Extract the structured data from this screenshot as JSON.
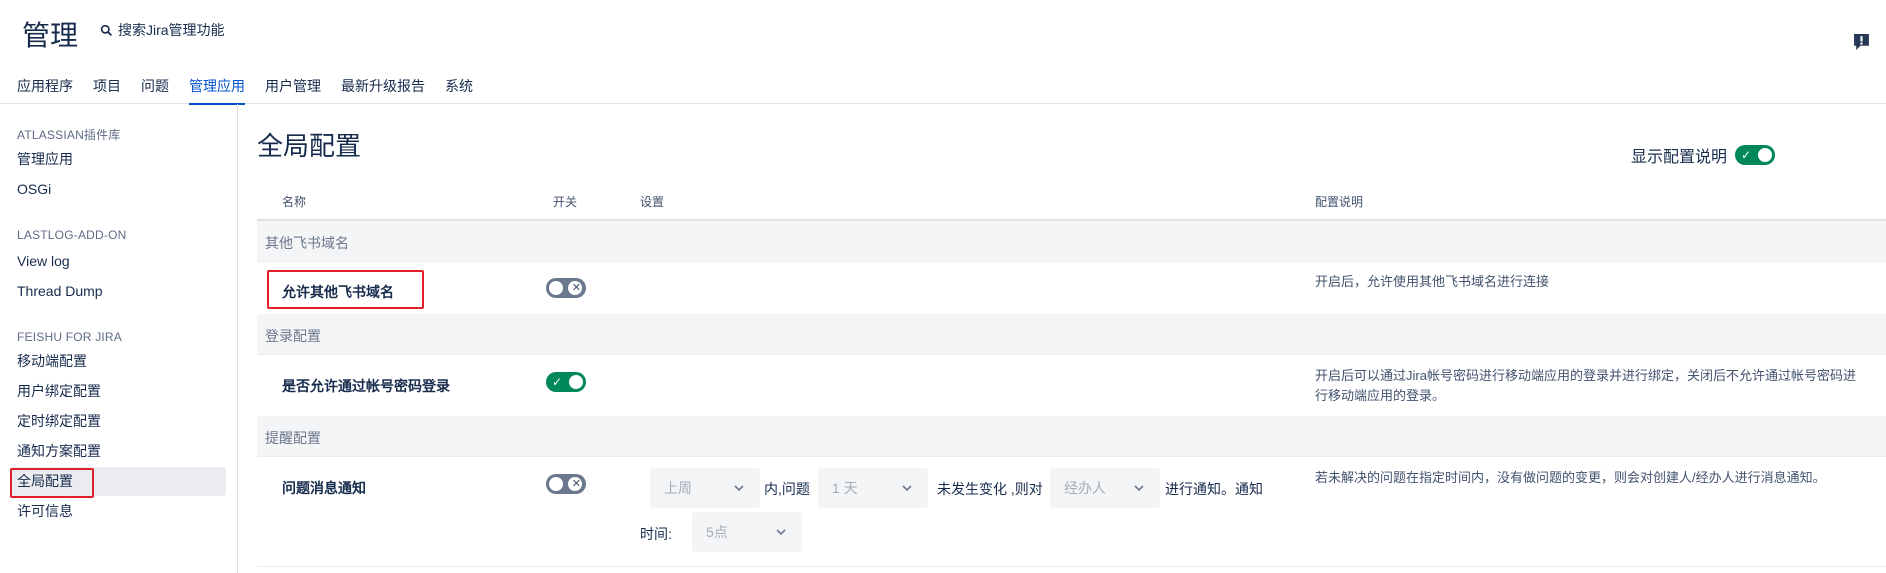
{
  "header": {
    "title": "管理",
    "search_label": "搜索Jira管理功能"
  },
  "tabs": [
    {
      "label": "应用程序"
    },
    {
      "label": "项目"
    },
    {
      "label": "问题"
    },
    {
      "label": "管理应用",
      "active": true
    },
    {
      "label": "用户管理"
    },
    {
      "label": "最新升级报告"
    },
    {
      "label": "系统"
    }
  ],
  "sidebar": {
    "sections": [
      {
        "title": "ATLASSIAN插件库",
        "items": [
          "管理应用",
          "OSGi"
        ]
      },
      {
        "title": "LASTLOG-ADD-ON",
        "items": [
          "View log",
          "Thread Dump"
        ]
      },
      {
        "title": "FEISHU FOR JIRA",
        "items": [
          "移动端配置",
          "用户绑定配置",
          "定时绑定配置",
          "通知方案配置",
          "全局配置",
          "许可信息"
        ]
      }
    ],
    "active_item": "全局配置"
  },
  "main": {
    "title": "全局配置",
    "show_desc_label": "显示配置说明",
    "show_desc_on": true,
    "columns": {
      "name": "名称",
      "switch": "开关",
      "settings": "设置",
      "description": "配置说明"
    },
    "groups": [
      {
        "title": "其他飞书域名",
        "row": {
          "name": "允许其他飞书域名",
          "enabled": false,
          "description": "开启后，允许使用其他飞书域名进行连接"
        }
      },
      {
        "title": "登录配置",
        "row": {
          "name": "是否允许通过帐号密码登录",
          "enabled": true,
          "description": "开启后可以通过Jira帐号密码进行移动端应用的登录并进行绑定，关闭后不允许通过帐号密码进行移动端应用的登录。"
        }
      },
      {
        "title": "提醒配置",
        "row": {
          "name": "问题消息通知",
          "enabled": false,
          "description": "若未解决的问题在指定时间内，没有做问题的变更，则会对创建人/经办人进行消息通知。",
          "settings": {
            "period": "上周",
            "text1": "内,问题",
            "duration": "1 天",
            "text2": "未发生变化 ,则对",
            "target": "经办人",
            "text3": "进行通知。通知",
            "time_label": "时间:",
            "time": "5点"
          }
        }
      }
    ]
  },
  "colors": {
    "accent": "#0052cc",
    "toggle_on": "#00875a",
    "toggle_off": "#6b778c",
    "highlight_box": "#e0202a"
  }
}
